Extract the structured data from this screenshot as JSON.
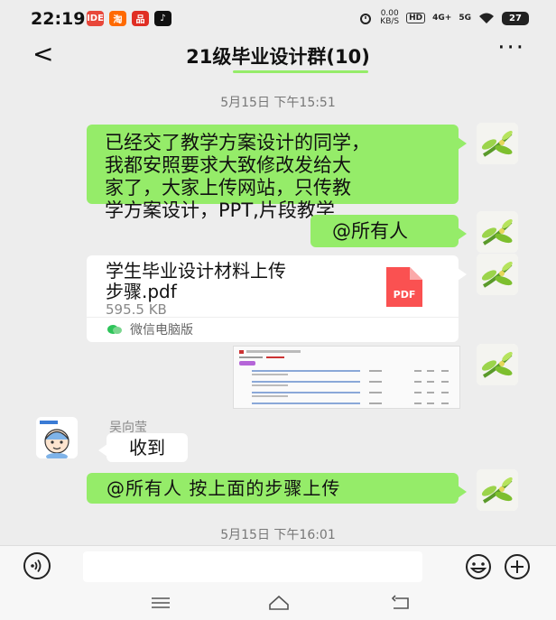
{
  "status_bar": {
    "time": "22:19",
    "app_icons": [
      {
        "name": "app-icon-1",
        "label": "IDE",
        "color": "#e8473a"
      },
      {
        "name": "app-icon-2",
        "label": "淘",
        "color": "#ff6a00"
      },
      {
        "name": "app-icon-3",
        "label": "品",
        "color": "#e02e24"
      },
      {
        "name": "app-icon-4",
        "label": "♪",
        "color": "#111111"
      }
    ],
    "net_speed_value": "0.00",
    "net_speed_unit": "KB/S",
    "hd": "HD",
    "signal_1": "4G+",
    "signal_2": "5G",
    "battery": "27"
  },
  "nav": {
    "back": "<",
    "title": "21级毕业设计群(10)",
    "more": "···"
  },
  "messages": {
    "ts1": "5月15日 下午15:51",
    "msg1_lines": [
      "已经交了教学方案设计的同学，",
      "我都安照要求大致修改发给大",
      "家了，大家上传网站，只传教",
      "学方案设计，PPT,片段教学"
    ],
    "msg2": "@所有人",
    "file_name_line1": "学生毕业设计材料上传",
    "file_name_line2": "步骤.pdf",
    "file_size": "595.5 KB",
    "pdf_label": "PDF",
    "file_source": "微信电脑版",
    "sender_name": "吴向莹",
    "msg3": "收到",
    "msg4": "@所有人  按上面的步骤上传",
    "ts2": "5月15日 下午16:01"
  },
  "input": {
    "placeholder": ""
  },
  "colors": {
    "my_bubble": "#95ec69",
    "pdf_red": "#fa5151",
    "background": "#ededed"
  },
  "icons": {
    "voice": "voice-icon",
    "emoji": "emoji-icon",
    "plus": "plus-icon",
    "menu": "menu-icon",
    "home": "home-icon",
    "back_key": "back-key-icon"
  }
}
